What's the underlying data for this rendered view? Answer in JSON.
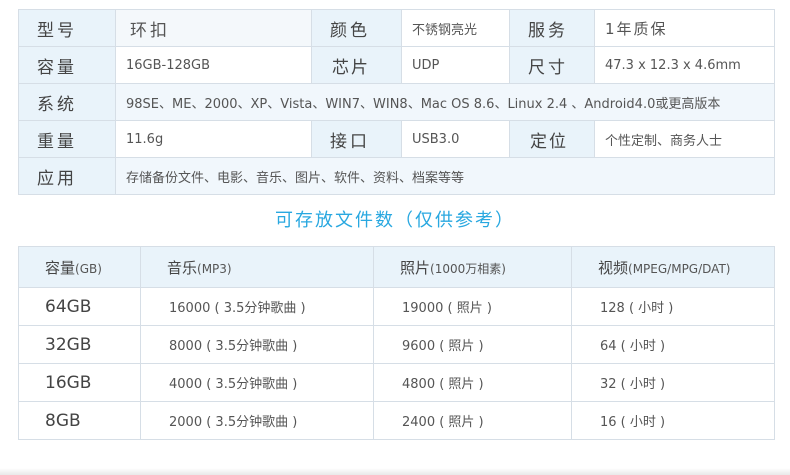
{
  "spec": {
    "row1": {
      "l1": "型号",
      "v1": "环扣",
      "l2": "颜色",
      "v2": "不锈钢亮光",
      "l3": "服务",
      "v3": "1年质保"
    },
    "row2": {
      "l1": "容量",
      "v1": "16GB-128GB",
      "l2": "芯片",
      "v2": "UDP",
      "l3": "尺寸",
      "v3": "47.3 x 12.3 x 4.6mm"
    },
    "row3": {
      "l1": "系统",
      "v1": "98SE、ME、2000、XP、Vista、WIN7、WIN8、Mac OS 8.6、Linux 2.4 、Android4.0或更高版本"
    },
    "row4": {
      "l1": "重量",
      "v1": "11.6g",
      "l2": "接口",
      "v2": "USB3.0",
      "l3": "定位",
      "v3": "个性定制、商务人士"
    },
    "row5": {
      "l1": "应用",
      "v1": "存储备份文件、电影、音乐、图片、软件、资料、档案等等"
    }
  },
  "caption": "可存放文件数（仅供参考）",
  "files": {
    "headers": [
      {
        "main": "容量",
        "sub": "(GB)"
      },
      {
        "main": "音乐",
        "sub": "(MP3)"
      },
      {
        "main": "照片",
        "sub": "(1000万相素)"
      },
      {
        "main": "视频",
        "sub": "(MPEG/MPG/DAT)"
      }
    ],
    "rows": [
      [
        "64GB",
        "16000 ( 3.5分钟歌曲 )",
        "19000 ( 照片 )",
        "128 ( 小时 )"
      ],
      [
        "32GB",
        "8000 ( 3.5分钟歌曲 )",
        "9600 ( 照片 )",
        "64 ( 小时 )"
      ],
      [
        "16GB",
        "4000 ( 3.5分钟歌曲 )",
        "4800 ( 照片 )",
        "32 ( 小时 )"
      ],
      [
        "8GB",
        "2000 ( 3.5分钟歌曲 )",
        "2400 ( 照片 )",
        "16 ( 小时 )"
      ]
    ]
  }
}
